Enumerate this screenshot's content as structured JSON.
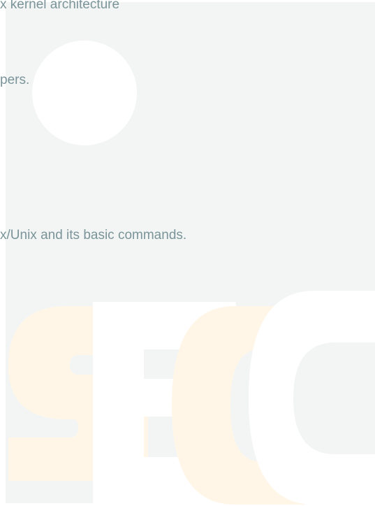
{
  "content": {
    "line_1": "x kernel architecture",
    "line_2": "pers.",
    "line_3": "x/Unix and its basic commands."
  },
  "watermark": {
    "letters": [
      "S",
      "E",
      "C",
      "C"
    ],
    "colors": {
      "s_letter": "#fff6e8",
      "e_letter": "#ffffff",
      "c_letter_orange": "#fff6e8",
      "c_letter_white": "#ffffff"
    }
  },
  "colors": {
    "panel_background": "#f3f5f4",
    "text": "#7a9499",
    "page_background": "#ffffff"
  }
}
